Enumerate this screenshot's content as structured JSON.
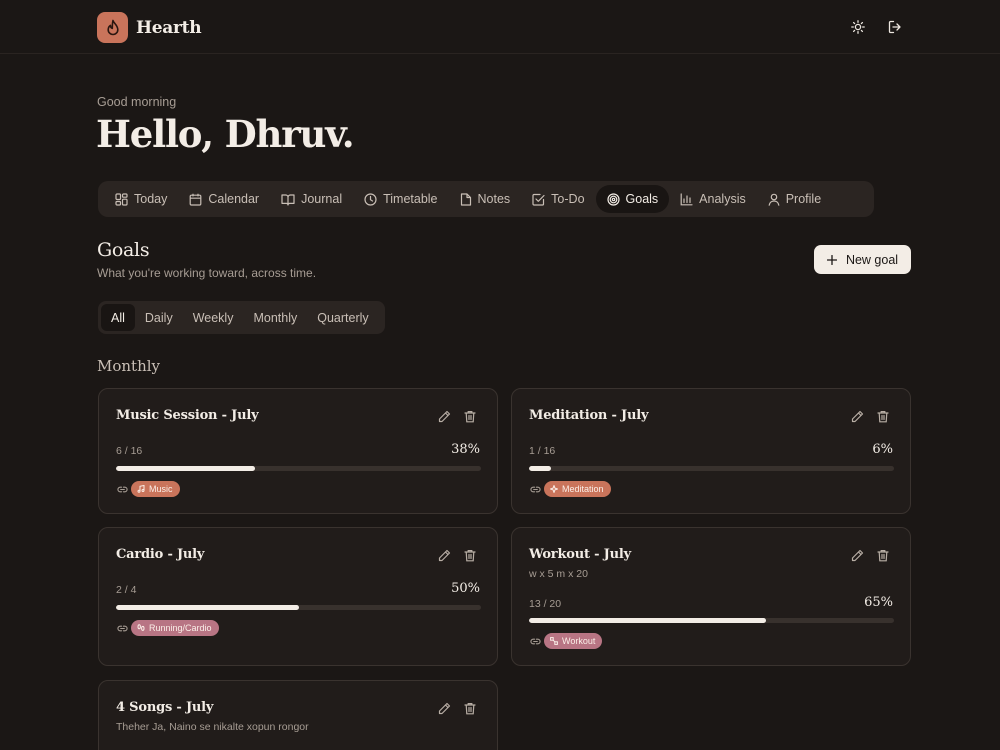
{
  "app": {
    "name": "Hearth",
    "logo_icon": "flame-icon",
    "accent": "#c9745b"
  },
  "header_icons": [
    {
      "name": "theme-toggle-icon",
      "icon": "sun-icon"
    },
    {
      "name": "sign-out-icon",
      "icon": "logout-icon"
    }
  ],
  "greeting": {
    "subtitle": "Good morning",
    "title": "Hello, Dhruv."
  },
  "nav": {
    "items": [
      {
        "label": "Today",
        "icon": "grid-icon",
        "active": false
      },
      {
        "label": "Calendar",
        "icon": "calendar-icon",
        "active": false
      },
      {
        "label": "Journal",
        "icon": "book-icon",
        "active": false
      },
      {
        "label": "Timetable",
        "icon": "clock-icon",
        "active": false
      },
      {
        "label": "Notes",
        "icon": "file-icon",
        "active": false
      },
      {
        "label": "To-Do",
        "icon": "checkbox-icon",
        "active": false
      },
      {
        "label": "Goals",
        "icon": "target-icon",
        "active": true
      },
      {
        "label": "Analysis",
        "icon": "bar-chart-icon",
        "active": false
      },
      {
        "label": "Profile",
        "icon": "user-icon",
        "active": false
      }
    ]
  },
  "section": {
    "title": "Goals",
    "subtitle": "What you're working toward, across time.",
    "new_goal_label": "New goal"
  },
  "filters": {
    "items": [
      "All",
      "Daily",
      "Weekly",
      "Monthly",
      "Quarterly"
    ],
    "active": "All"
  },
  "groups": [
    {
      "title": "Monthly"
    }
  ],
  "goals": [
    {
      "title": "Music Session - July",
      "description": "",
      "count": "6 / 16",
      "percent_label": "38%",
      "progress": 0.38,
      "tag": "Music",
      "tag_icon": "music-note-icon",
      "tag_color": "#c9745b"
    },
    {
      "title": "Meditation - July",
      "description": "",
      "count": "1 / 16",
      "percent_label": "6%",
      "progress": 0.06,
      "tag": "Meditation",
      "tag_icon": "sparkle-icon",
      "tag_color": "#c9745b"
    },
    {
      "title": "Cardio - July",
      "description": "",
      "count": "2 / 4",
      "percent_label": "50%",
      "progress": 0.5,
      "tag": "Running/Cardio",
      "tag_icon": "footprints-icon",
      "tag_color": "#b87584"
    },
    {
      "title": "Workout - July",
      "description": "w x 5 m x 20",
      "count": "13 / 20",
      "percent_label": "65%",
      "progress": 0.65,
      "tag": "Workout",
      "tag_icon": "dumbbell-icon",
      "tag_color": "#b87584"
    },
    {
      "title": "4 Songs - July",
      "description": "Theher Ja, Naino se nikalte xopun rongor",
      "count": "",
      "percent_label": "",
      "progress": 0,
      "tag": "",
      "tag_icon": "",
      "tag_color": "#c9745b"
    }
  ]
}
